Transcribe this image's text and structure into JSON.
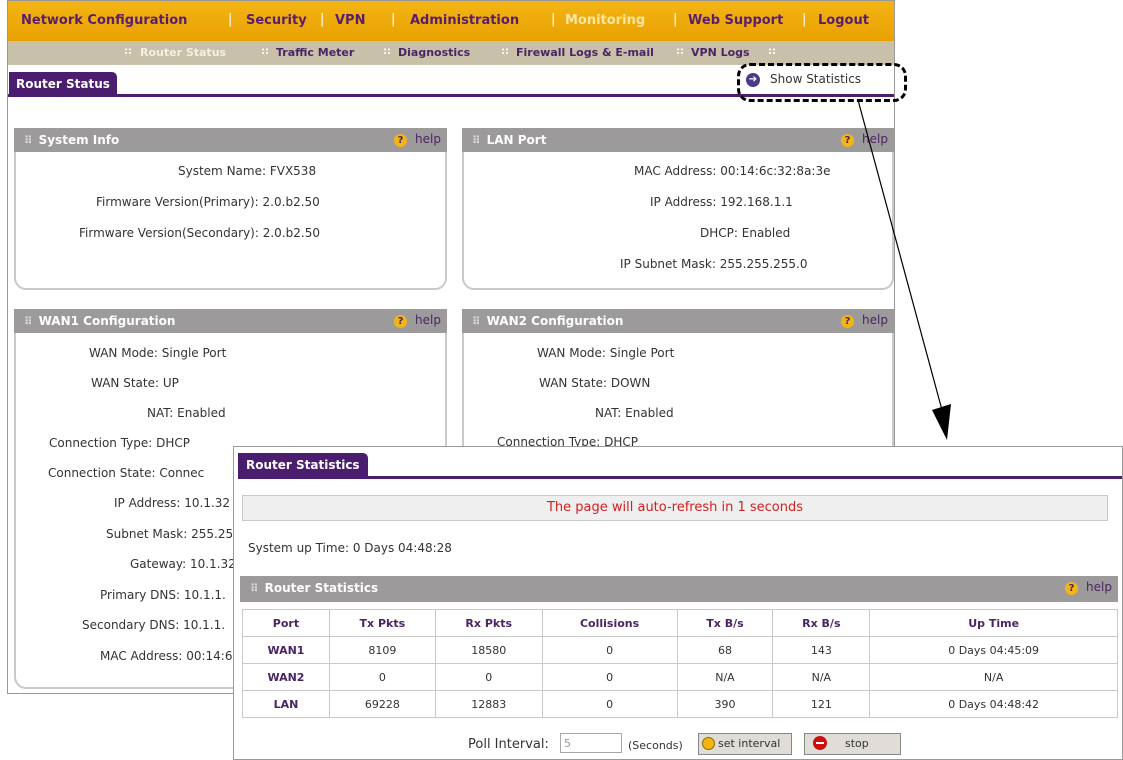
{
  "nav": {
    "items": [
      "Network Configuration",
      "Security",
      "VPN",
      "Administration",
      "Monitoring",
      "Web Support",
      "Logout"
    ],
    "sub_items": [
      "Router Status",
      "Traffic Meter",
      "Diagnostics",
      "Firewall Logs & E-mail",
      "VPN Logs"
    ]
  },
  "page": {
    "tab": "Router Status",
    "show_statistics": "Show Statistics"
  },
  "help_label": "help",
  "system_info": {
    "title": "System Info",
    "rows": [
      {
        "label": "System Name:",
        "value": "FVX538"
      },
      {
        "label": "Firmware Version(Primary):",
        "value": "2.0.b2.50"
      },
      {
        "label": "Firmware Version(Secondary):",
        "value": "2.0.b2.50"
      }
    ]
  },
  "lan_port": {
    "title": "LAN Port",
    "rows": [
      {
        "label": "MAC Address:",
        "value": "00:14:6c:32:8a:3e"
      },
      {
        "label": "IP Address:",
        "value": "192.168.1.1"
      },
      {
        "label": "DHCP:",
        "value": "Enabled"
      },
      {
        "label": "IP Subnet Mask:",
        "value": "255.255.255.0"
      }
    ]
  },
  "wan1": {
    "title": "WAN1 Configuration",
    "rows": [
      {
        "label": "WAN Mode:",
        "value": "Single Port"
      },
      {
        "label": "WAN State:",
        "value": "UP"
      },
      {
        "label": "NAT:",
        "value": "Enabled"
      },
      {
        "label": "Connection Type:",
        "value": "DHCP"
      },
      {
        "label": "Connection State:",
        "value": "Connec"
      },
      {
        "label": "IP Address:",
        "value": "10.1.32"
      },
      {
        "label": "Subnet Mask:",
        "value": "255.255"
      },
      {
        "label": "Gateway:",
        "value": "10.1.32"
      },
      {
        "label": "Primary DNS:",
        "value": "10.1.1."
      },
      {
        "label": "Secondary DNS:",
        "value": "10.1.1."
      },
      {
        "label": "MAC Address:",
        "value": "00:14:6"
      }
    ]
  },
  "wan2": {
    "title": "WAN2 Configuration",
    "rows": [
      {
        "label": "WAN Mode:",
        "value": "Single Port"
      },
      {
        "label": "WAN State:",
        "value": "DOWN"
      },
      {
        "label": "NAT:",
        "value": "Enabled"
      },
      {
        "label": "Connection Type:",
        "value": "DHCP"
      }
    ]
  },
  "stats": {
    "tab": "Router Statistics",
    "refresh_msg": "The page will auto-refresh in 1 seconds",
    "uptime": "System up Time: 0 Days 04:48:28",
    "panel_title": "Router Statistics",
    "columns": [
      "Port",
      "Tx Pkts",
      "Rx Pkts",
      "Collisions",
      "Tx B/s",
      "Rx B/s",
      "Up Time"
    ],
    "rows": [
      [
        "WAN1",
        "8109",
        "18580",
        "0",
        "68",
        "143",
        "0 Days 04:45:09"
      ],
      [
        "WAN2",
        "0",
        "0",
        "0",
        "N/A",
        "N/A",
        "N/A"
      ],
      [
        "LAN",
        "69228",
        "12883",
        "0",
        "390",
        "121",
        "0 Days 04:48:42"
      ]
    ],
    "poll_label": "Poll Interval:",
    "poll_value": "5",
    "seconds": "(Seconds)",
    "set_interval": "set interval",
    "stop": "stop"
  },
  "colors": {
    "nav_orange": "#f3b515",
    "purple": "#4a1d6e",
    "refresh_red": "#d42020"
  }
}
